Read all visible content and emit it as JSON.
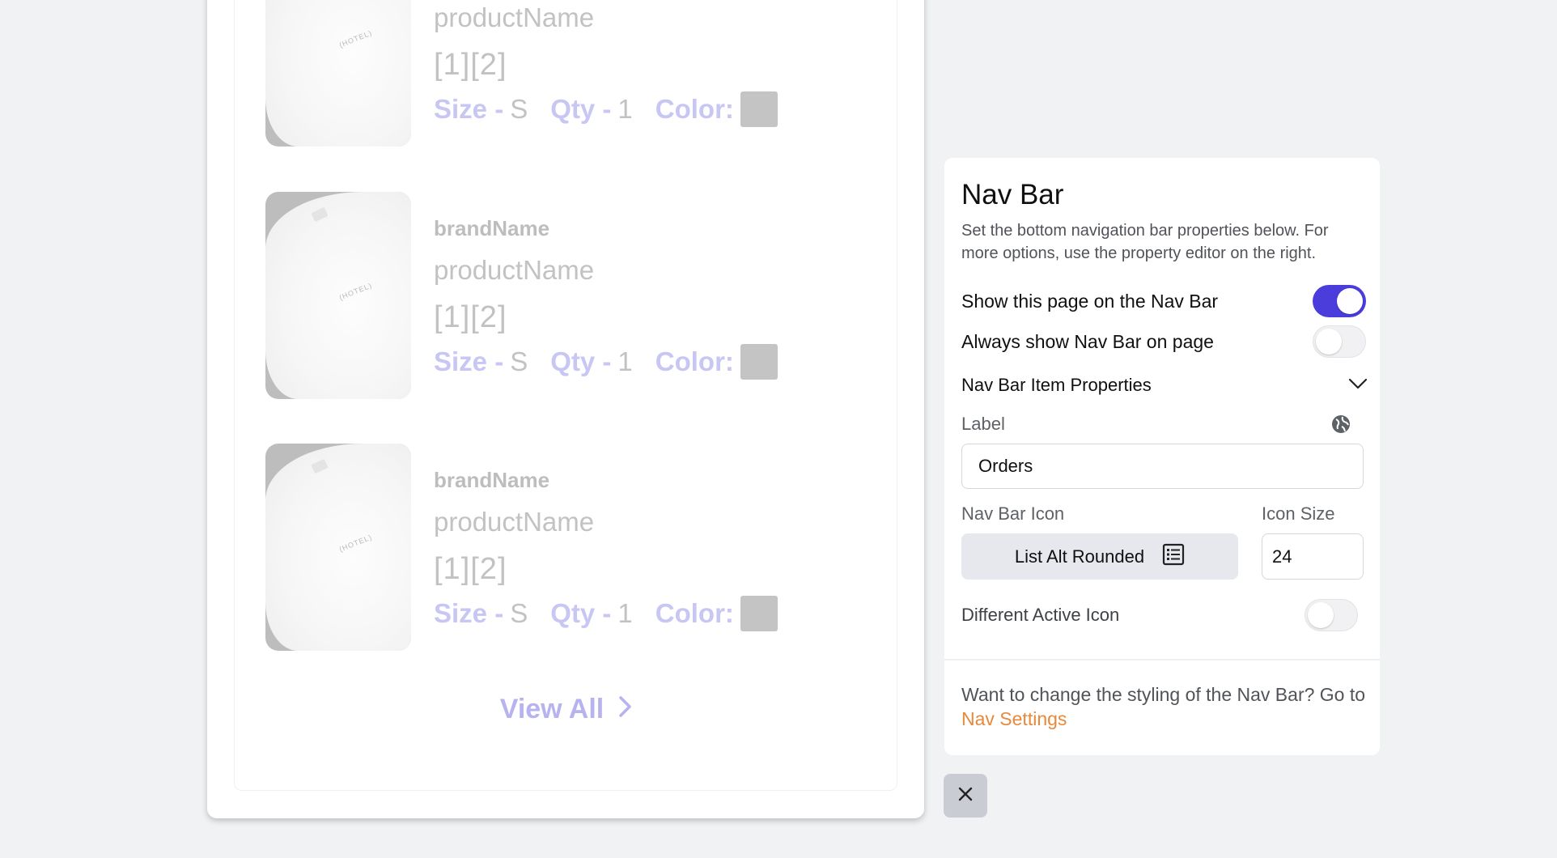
{
  "preview": {
    "items": [
      {
        "brand": "",
        "product": "productName",
        "price": "[1][2]",
        "size_label": "Size -",
        "size": "S",
        "qty_label": "Qty -",
        "qty": "1",
        "color_label": "Color:",
        "hotel": "(HOTEL)"
      },
      {
        "brand": "brandName",
        "product": "productName",
        "price": "[1][2]",
        "size_label": "Size -",
        "size": "S",
        "qty_label": "Qty -",
        "qty": "1",
        "color_label": "Color:",
        "hotel": "(HOTEL)"
      },
      {
        "brand": "brandName",
        "product": "productName",
        "price": "[1][2]",
        "size_label": "Size -",
        "size": "S",
        "qty_label": "Qty -",
        "qty": "1",
        "color_label": "Color:",
        "hotel": "(HOTEL)"
      }
    ],
    "view_all": "View All"
  },
  "panel": {
    "title": "Nav Bar",
    "description": "Set the bottom navigation bar properties below. For more options, use the property editor on the right.",
    "show_on_nav_label": "Show this page on the Nav Bar",
    "show_on_nav": true,
    "always_show_label": "Always show Nav Bar on page",
    "always_show": false,
    "item_props_label": "Nav Bar Item Properties",
    "label_field_label": "Label",
    "label_value": "Orders",
    "icon_field_label": "Nav Bar Icon",
    "icon_value": "List Alt Rounded",
    "icon_size_label": "Icon Size",
    "icon_size_value": "24",
    "different_active_label": "Different Active Icon",
    "different_active": false,
    "footer_text": "Want to change the styling of the Nav Bar? Go to",
    "footer_link": "Nav Settings"
  },
  "colors": {
    "accent": "#4b3ddc",
    "link": "#e8883a",
    "muted_purple": "#c8c6f2"
  },
  "icons": {
    "globe": "globe-icon",
    "list_alt": "list-alt-icon",
    "chevron": "chevron-down-icon",
    "close": "close-icon"
  }
}
